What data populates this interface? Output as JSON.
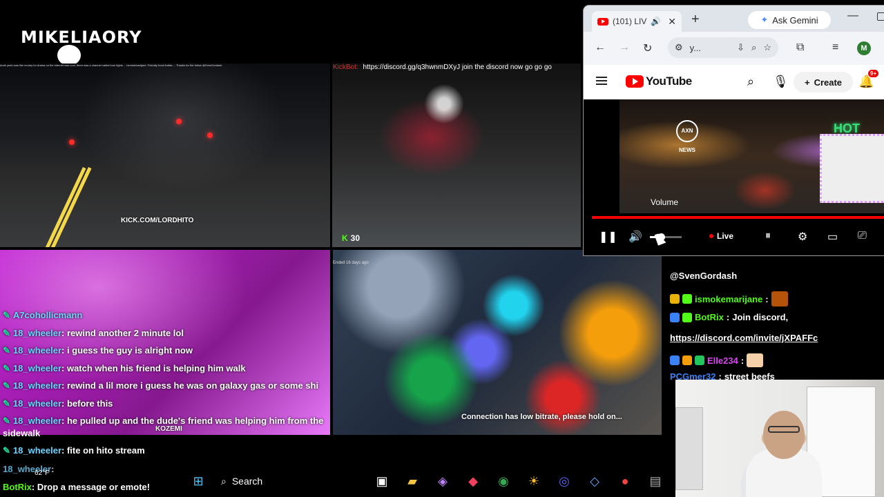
{
  "overlay": {
    "logo_text": "MIKELIAORY",
    "ticker": "dude yeah was like money for drama on the internet was cool, there was a channel called bum fights ... ismokemarijane: Friendly hood frailss ... Thanks for the follow @SvenGordash"
  },
  "tiles": {
    "tl_watermark": "KICK.COM/LORDHITO",
    "tr_kickbot_name": "KickBot:",
    "tr_kickbot_msg": "https://discord.gg/q3hwnmDXyJ join the discord now go go go",
    "tr_viewers": "30",
    "bl_watermark": "KOZEMI",
    "bm_ended": "Ended 16 days ago",
    "bm_connection": "Connection has low bitrate, please hold on..."
  },
  "left_chat": {
    "first_user": "A7cohollicmann",
    "lines": [
      {
        "user": "18_wheeler",
        "text": ": rewind another 2 minute lol"
      },
      {
        "user": "18_wheeler",
        "text": ": i guess the guy is alright now"
      },
      {
        "user": "18_wheeler",
        "text": ": watch when his friend is helping him walk"
      },
      {
        "user": "18_wheeler",
        "text": ": rewind a lil more i guess he was on galaxy gas or some shi"
      },
      {
        "user": "18_wheeler",
        "text": ": before this"
      },
      {
        "user": "18_wheeler",
        "text": ": he pulled up and the dude's friend was helping him from the"
      }
    ],
    "wrap_text": "sidewalk",
    "last_user": "18_wheeler",
    "last_text": ": fite on hito stream",
    "ghost_user": "18_wheeler",
    "ghost_text": ":",
    "botrix_user": "BotRix",
    "botrix_text": ": Drop a message or emote!"
  },
  "right_chat": {
    "row1_handle": "@SvenGordash",
    "row2_user": "ismokemarijane",
    "row3_user": "BotRix",
    "row3_text": "Join discord,",
    "row4_link": "https://discord.com/invite/jXPAFFc",
    "row5_user": "Elle234",
    "row6_user": "PCGmer32",
    "row6_text": "street beefs"
  },
  "browser": {
    "tab_title": "(101) LIV",
    "ask_gemini": "Ask Gemini",
    "omnibox_text": "y...",
    "profile_initial": "M",
    "youtube_label": "YouTube",
    "create_label": "Create",
    "notif_badge": "9+",
    "player": {
      "channel_logo": "AXN NEWS",
      "sign_text": "HOT",
      "volume_tooltip": "Volume",
      "volume_level": 0.35,
      "live_label": "Live"
    }
  },
  "taskbar": {
    "search_label": "Search",
    "temp": "62°F"
  },
  "colors": {
    "kick_green": "#53fc18",
    "yt_red": "#ff0000",
    "chat_user_blue": "#6fd3ff"
  }
}
